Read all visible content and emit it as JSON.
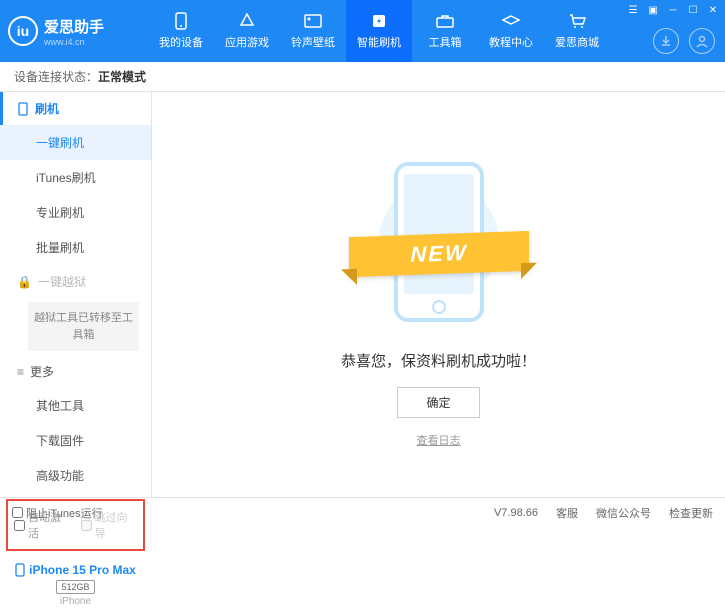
{
  "header": {
    "appName": "爱思助手",
    "appUrl": "www.i4.cn",
    "nav": [
      {
        "label": "我的设备"
      },
      {
        "label": "应用游戏"
      },
      {
        "label": "铃声壁纸"
      },
      {
        "label": "智能刷机"
      },
      {
        "label": "工具箱"
      },
      {
        "label": "教程中心"
      },
      {
        "label": "爱思商城"
      }
    ]
  },
  "status": {
    "label": "设备连接状态：",
    "value": "正常模式"
  },
  "sidebar": {
    "sec1": {
      "title": "刷机",
      "items": [
        "一键刷机",
        "iTunes刷机",
        "专业刷机",
        "批量刷机"
      ]
    },
    "sec2": {
      "title": "一键越狱",
      "note": "越狱工具已转移至工具箱"
    },
    "sec3": {
      "title": "更多",
      "items": [
        "其他工具",
        "下载固件",
        "高级功能"
      ]
    },
    "opts": {
      "auto": "自动激活",
      "skip": "跳过向导"
    },
    "device": {
      "name": "iPhone 15 Pro Max",
      "storage": "512GB",
      "type": "iPhone"
    }
  },
  "main": {
    "banner": "NEW",
    "message": "恭喜您，保资料刷机成功啦！",
    "okBtn": "确定",
    "logLink": "查看日志"
  },
  "footer": {
    "block": "阻止iTunes运行",
    "version": "V7.98.66",
    "links": [
      "客服",
      "微信公众号",
      "检查更新"
    ]
  }
}
